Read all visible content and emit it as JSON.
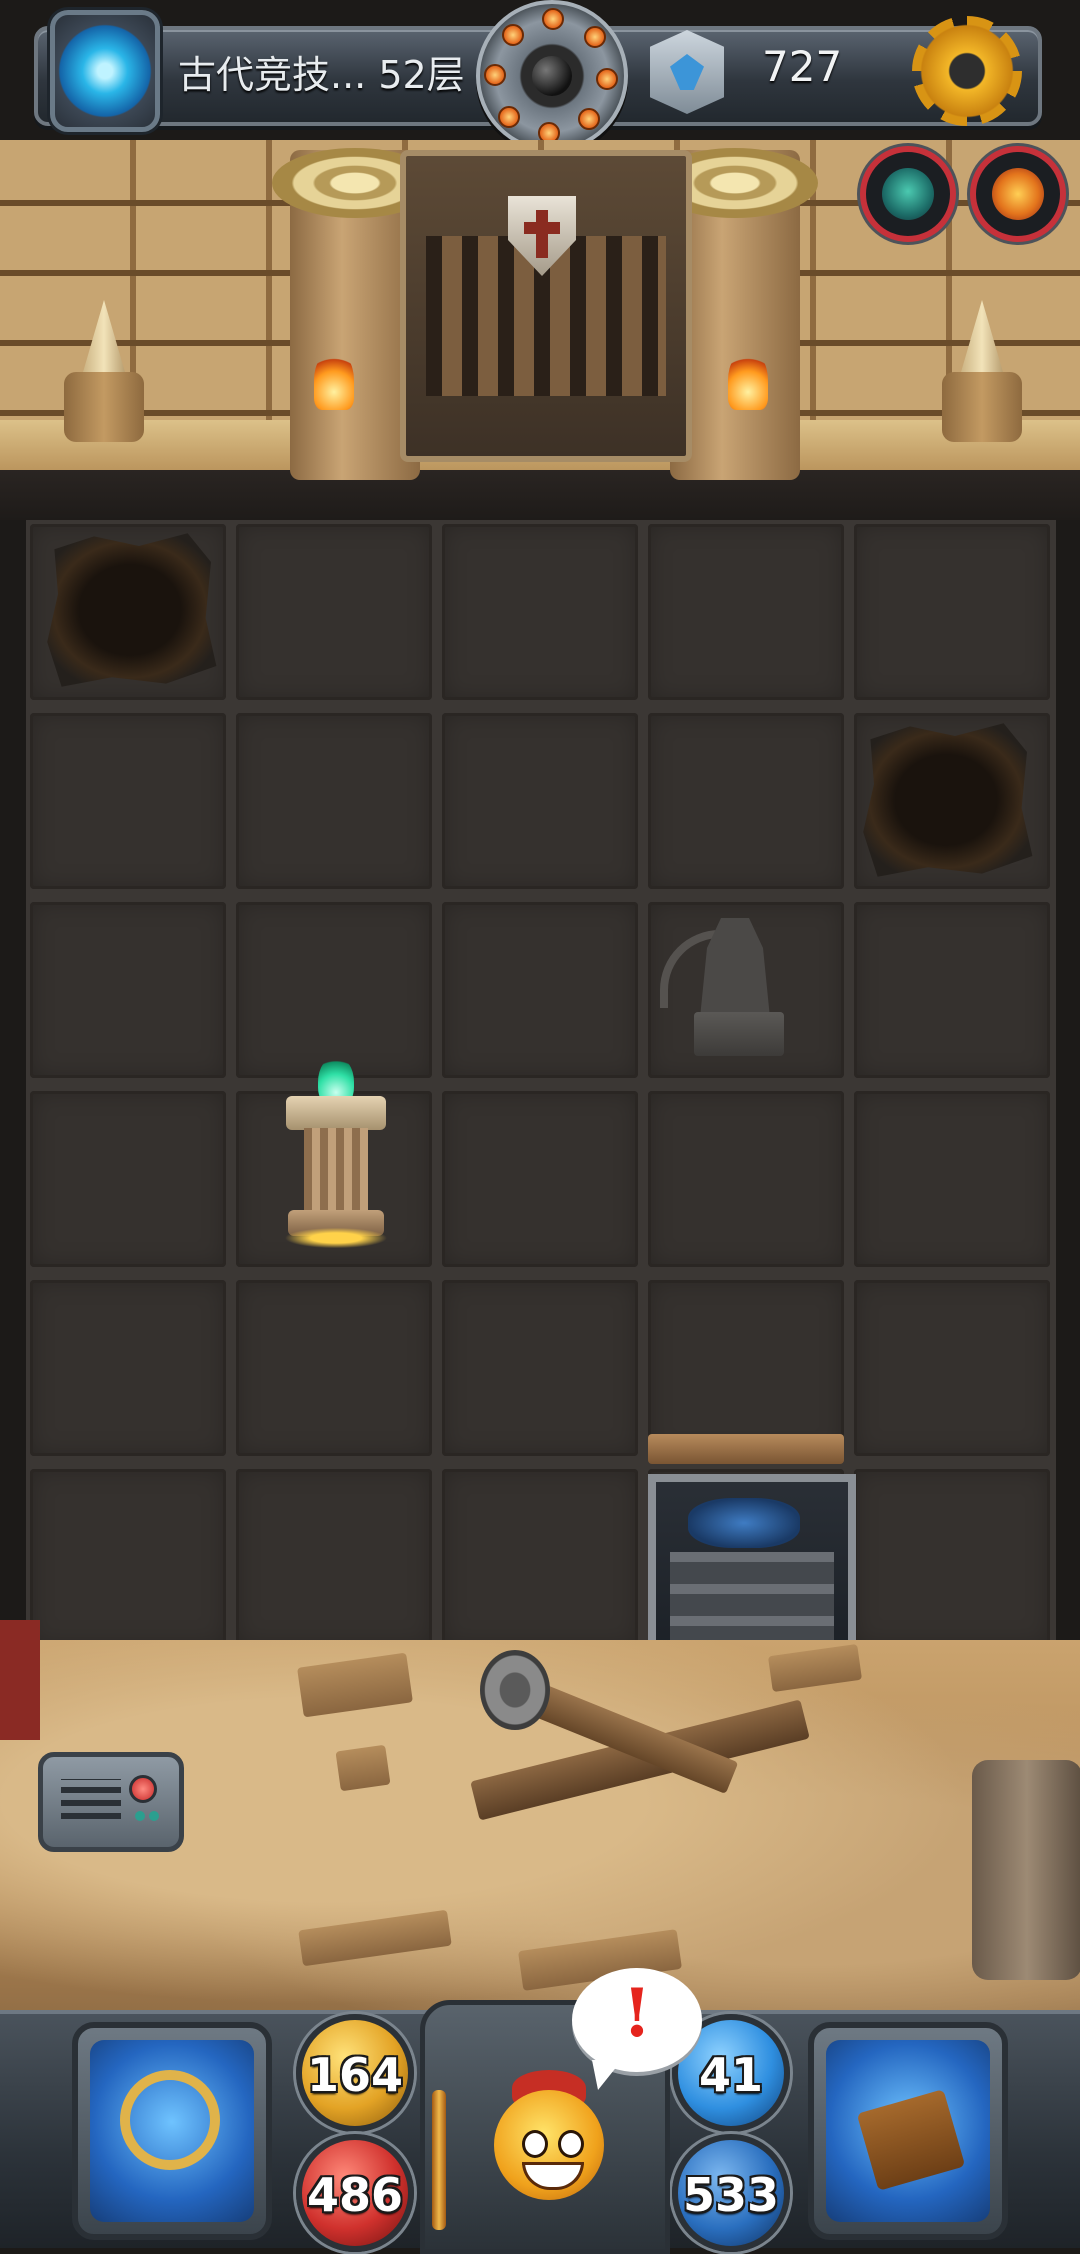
{
  "top_bar": {
    "floor_label": "古代竞技... 52层",
    "gem_count": "727"
  },
  "icons": {
    "portal": "portal-icon",
    "bomb": "bomb-wheel-icon",
    "gem": "gem-icon",
    "settings": "gear-icon",
    "chat": "chat-icon"
  },
  "stats": {
    "attack": "164",
    "hp": "486",
    "defense": "41",
    "mana": "533"
  },
  "alert": {
    "mark": "!"
  },
  "colors": {
    "attack_orb": "#e3a325",
    "hp_orb": "#d0312d",
    "defense_orb": "#2f8fe0",
    "mana_orb": "#2a6fbf",
    "enemy_ring": "#c6313a"
  }
}
